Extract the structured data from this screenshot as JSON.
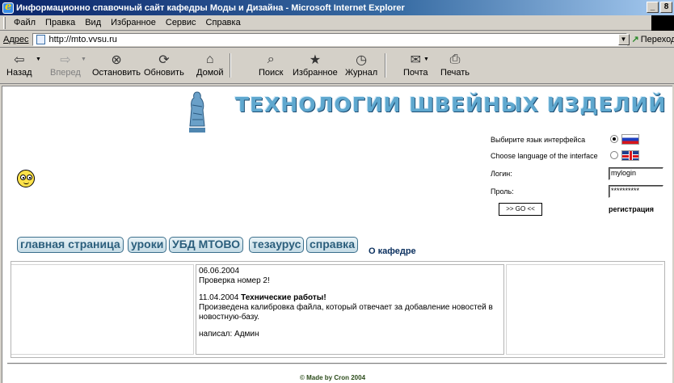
{
  "window": {
    "title": "Информационно спавочный сайт кафедры Моды и Дизайна - Microsoft Internet Explorer",
    "min": "_",
    "max": "8"
  },
  "menu": [
    "Файл",
    "Правка",
    "Вид",
    "Избранное",
    "Сервис",
    "Справка"
  ],
  "address": {
    "label": "Адрес",
    "url": "http://mto.vvsu.ru",
    "go_label": "Переход"
  },
  "toolbar": {
    "back": "Назад",
    "forward": "Вперед",
    "stop": "Остановить",
    "refresh": "Обновить",
    "home": "Домой",
    "search": "Поиск",
    "favorites": "Избранное",
    "history": "Журнал",
    "mail": "Почта",
    "print": "Печать"
  },
  "site": {
    "title": "ТЕХНОЛОГИИ ШВЕЙНЫХ ИЗДЕЛИЙ",
    "nav": [
      "главная страница",
      "уроки",
      "УБД МТОВО",
      "тезаурус",
      "справка"
    ],
    "about": "О кафедре",
    "login": {
      "lang_ru_label": "Выбирите язык интерфейса",
      "lang_en_label": "Choose language of the interface",
      "login_label": "Логин:",
      "login_value": "mylogin",
      "password_label": "Проль:",
      "password_value": "**********",
      "go_button": ">> GO <<",
      "register": "регистрация"
    },
    "news": {
      "date1": "06.06.2004",
      "text1": "Проверка номер 2!",
      "date2": "11.04.2004",
      "headline2": "Технические работы!",
      "text2": "Произведена калибровка файла, который отвечает за добавление новостей в новостную-базу.",
      "author": "написал: Админ"
    },
    "footer": "© Made by Cron 2004"
  }
}
